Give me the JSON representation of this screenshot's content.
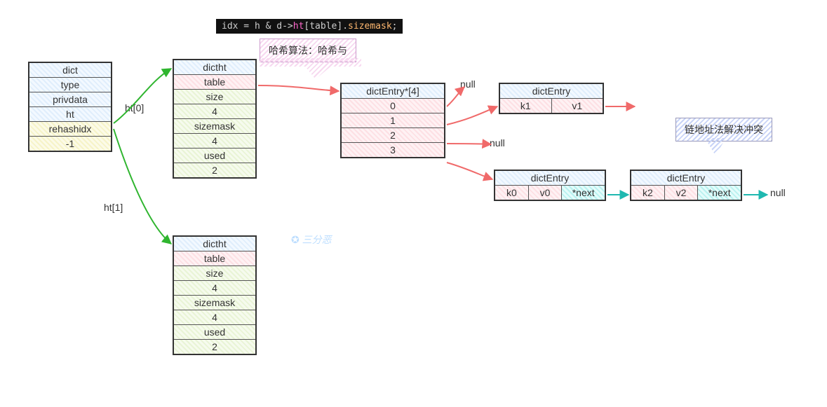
{
  "code": {
    "prefix": "idx = h & d->",
    "v1": "ht",
    "mid": "[table].",
    "v2": "sizemask",
    "suffix": ";"
  },
  "callouts": {
    "hash": "哈希算法：哈希与",
    "chain": "链地址法解决冲突"
  },
  "dict": {
    "title": "dict",
    "rows": [
      "type",
      "privdata",
      "ht"
    ],
    "rehash_label": "rehashidx",
    "rehash_val": "-1"
  },
  "edges": {
    "ht0": "ht[0]",
    "ht1": "ht[1]"
  },
  "dictht": {
    "title": "dictht",
    "table": "table",
    "size_l": "size",
    "size_v": "4",
    "mask_l": "sizemask",
    "mask_v": "4",
    "used_l": "used",
    "used_v0": "2",
    "used_v1": "2"
  },
  "array": {
    "title": "dictEntry*[4]",
    "slots": [
      "0",
      "1",
      "2",
      "3"
    ]
  },
  "nulls": {
    "n0": "null",
    "n2": "null",
    "end": "null"
  },
  "entry1": {
    "title": "dictEntry",
    "k": "k1",
    "v": "v1"
  },
  "entry0": {
    "title": "dictEntry",
    "k": "k0",
    "v": "v0",
    "next": "*next"
  },
  "entry2": {
    "title": "dictEntry",
    "k": "k2",
    "v": "v2",
    "next": "*next"
  },
  "wm": "三分恶"
}
